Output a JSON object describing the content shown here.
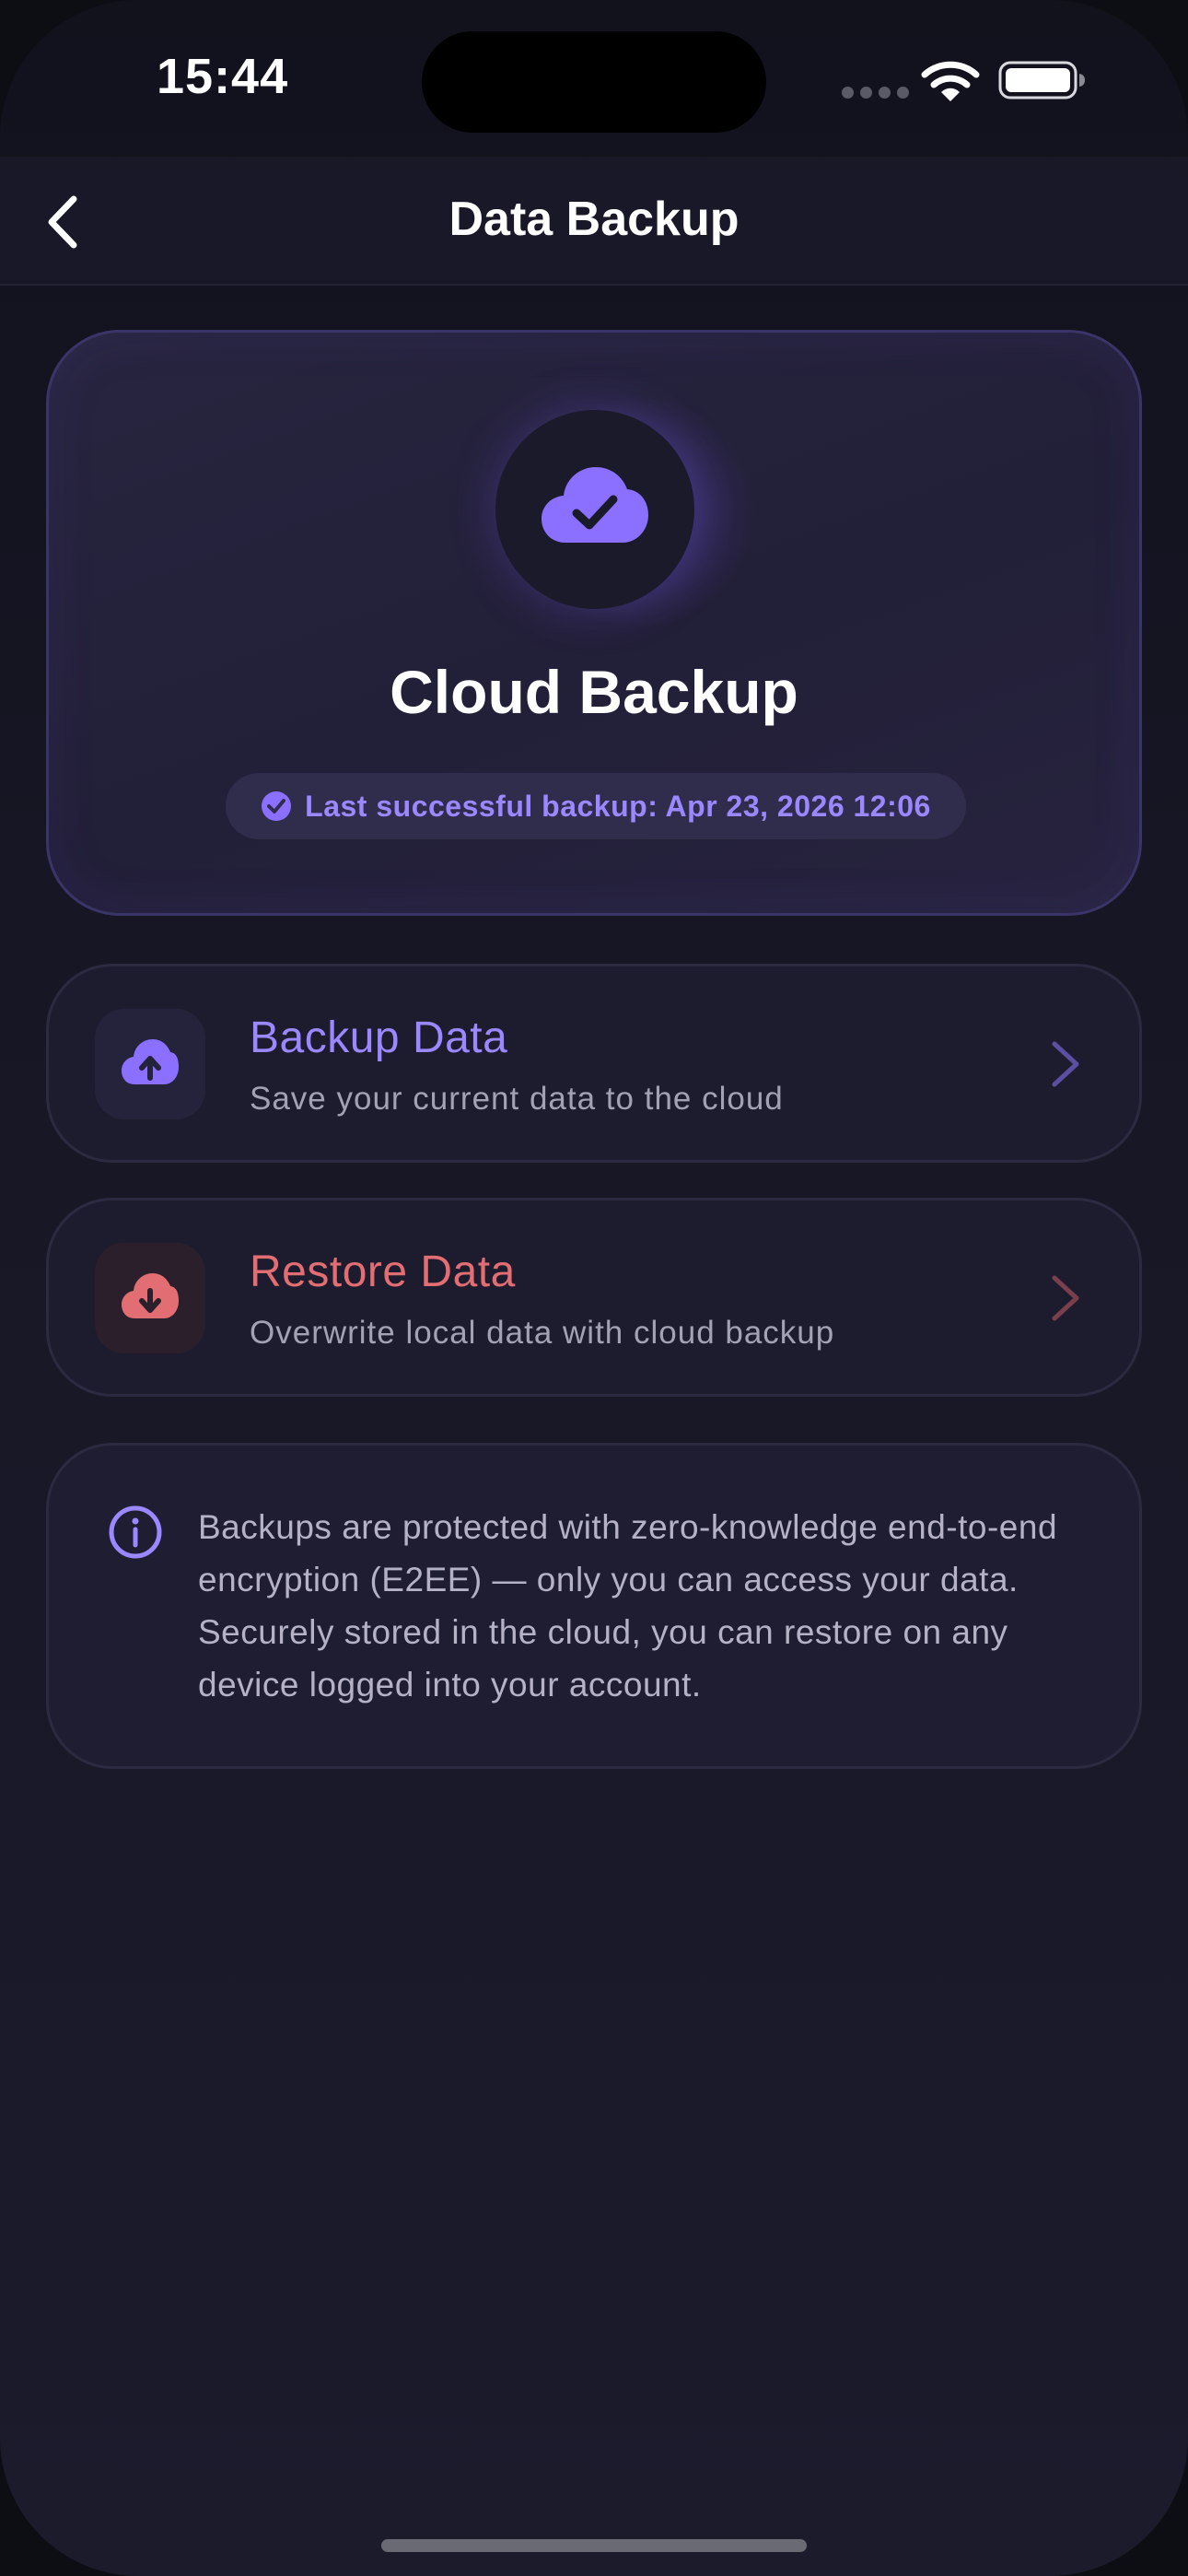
{
  "status_bar": {
    "time": "15:44"
  },
  "nav": {
    "title": "Data Backup",
    "back_icon": "chevron-left-icon"
  },
  "hero": {
    "icon": "cloud-check-icon",
    "title": "Cloud Backup",
    "status_icon": "check-circle-icon",
    "status_text": "Last successful backup: Apr 23, 2026 12:06"
  },
  "actions": [
    {
      "icon": "cloud-upload-icon",
      "title": "Backup Data",
      "subtitle": "Save your current data to the cloud",
      "accent": "#9b87ff"
    },
    {
      "icon": "cloud-download-icon",
      "title": "Restore Data",
      "subtitle": "Overwrite local data with cloud backup",
      "accent": "#e26d72"
    }
  ],
  "info": {
    "icon": "info-icon",
    "text": "Backups are protected with zero-knowledge end-to-end encryption (E2EE) — only you can access your data. Securely stored in the cloud, you can restore on any device logged into your account."
  },
  "colors": {
    "background": "#171726",
    "primary_accent": "#9b87ff",
    "danger_accent": "#e26d72",
    "card": "#1d1c2e",
    "hero_card": "#25223d"
  }
}
